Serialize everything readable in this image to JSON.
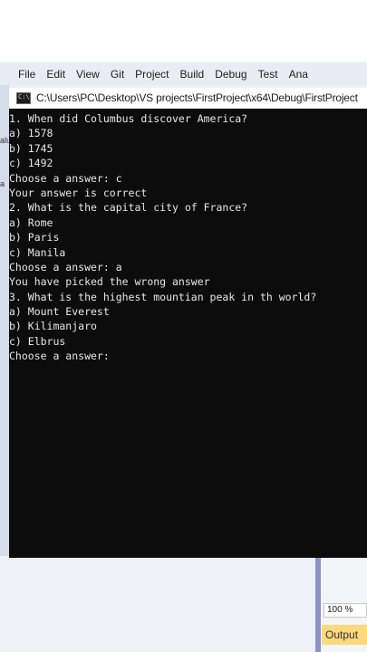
{
  "menu": [
    "File",
    "Edit",
    "View",
    "Git",
    "Project",
    "Build",
    "Debug",
    "Test",
    "Ana"
  ],
  "console": {
    "title": "C:\\Users\\PC\\Desktop\\VS projects\\FirstProject\\x64\\Debug\\FirstProject",
    "icon_text": "C:\\",
    "lines": [
      "1. When did Columbus discover America?",
      "a) 1578",
      "b) 1745",
      "c) 1492",
      "Choose a answer: c",
      "Your answer is correct",
      "2. What is the capital city of France?",
      "a) Rome",
      "b) Paris",
      "c) Manila",
      "Choose a answer: a",
      "You have picked the wrong answer",
      "3. What is the highest mountian peak in th world?",
      "a) Mount Everest",
      "b) Kilimanjaro",
      "c) Elbrus",
      "Choose a answer:"
    ]
  },
  "left_fragments": [
    "alu",
    "a"
  ],
  "zoom_level": "100 %",
  "output_tab_label": "Output"
}
